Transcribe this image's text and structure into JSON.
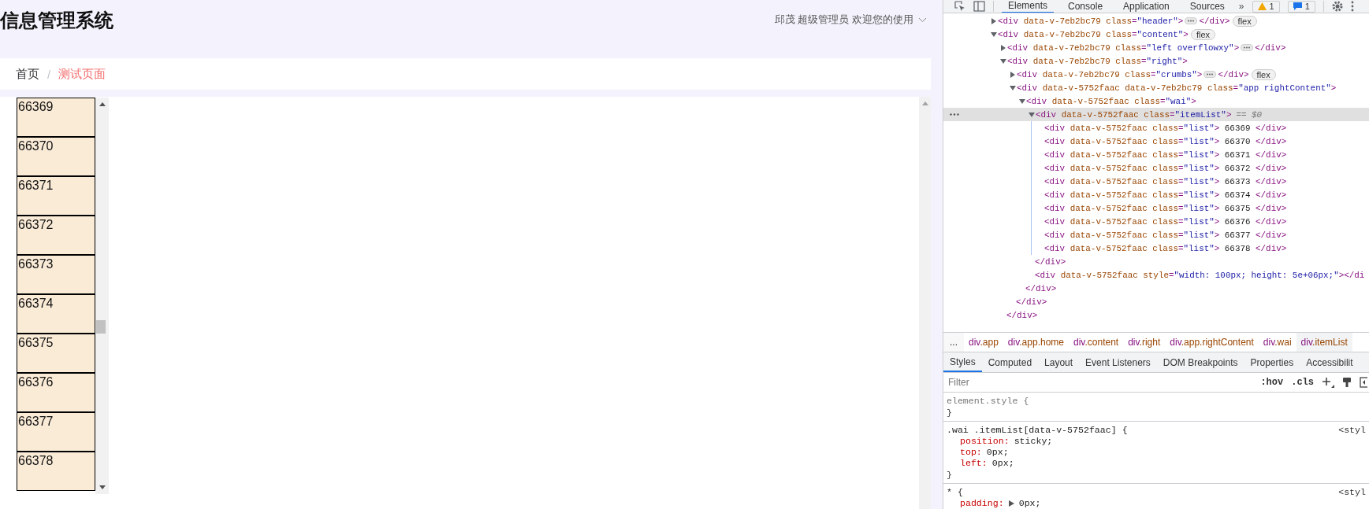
{
  "page": {
    "header": {
      "title": "信息管理系统",
      "user": "邱茂 超级管理员 欢迎您的使用"
    },
    "breadcrumb": {
      "separator": "/",
      "items": [
        {
          "label": "首页",
          "selected": false
        },
        {
          "label": "测试页面",
          "selected": true
        }
      ]
    },
    "list_items": [
      {
        "label": "66369"
      },
      {
        "label": "66370"
      },
      {
        "label": "66371"
      },
      {
        "label": "66372"
      },
      {
        "label": "66373"
      },
      {
        "label": "66374"
      },
      {
        "label": "66375"
      },
      {
        "label": "66376"
      },
      {
        "label": "66377"
      },
      {
        "label": "66378"
      }
    ]
  },
  "devtools": {
    "tabs": [
      {
        "label": "Elements",
        "selected": true
      },
      {
        "label": "Console",
        "selected": false
      },
      {
        "label": "Application",
        "selected": false
      },
      {
        "label": "Sources",
        "selected": false
      }
    ],
    "more": "»",
    "warnings": "1",
    "messages": "1",
    "dom_tree": [
      {
        "kind": "element",
        "open": "<div data-v-7eb2bc79 class=\"header\">",
        "close": "</div>",
        "badge": "flex",
        "expanded": false,
        "selected": false
      },
      {
        "kind": "element",
        "open": "<div data-v-7eb2bc79 class=\"content\">",
        "badge": "flex",
        "expanded": true,
        "selected": false,
        "children": [
          {
            "kind": "element",
            "open": "<div data-v-7eb2bc79 class=\"left overflowxy\">",
            "close": "</div>",
            "expanded": false,
            "selected": false
          },
          {
            "kind": "element",
            "open": "<div data-v-7eb2bc79 class=\"right\">",
            "close": "</div>",
            "expanded": true,
            "selected": false,
            "children": [
              {
                "kind": "element",
                "open": "<div data-v-7eb2bc79 class=\"crumbs\">",
                "close": "</div>",
                "badge": "flex",
                "expanded": false,
                "selected": false
              },
              {
                "kind": "element",
                "open": "<div data-v-5752faac data-v-7eb2bc79 class=\"app rightContent\">",
                "close": "</div>",
                "expanded": true,
                "selected": false,
                "children": [
                  {
                    "kind": "element",
                    "open": "<div data-v-5752faac class=\"wai\">",
                    "close": "</div>",
                    "expanded": true,
                    "selected": false,
                    "children": [
                      {
                        "kind": "element",
                        "open": "<div data-v-5752faac class=\"itemList\">",
                        "suffix": "== $0",
                        "close": "</div>",
                        "expanded": true,
                        "selected": true,
                        "children": [
                          {
                            "kind": "leaf",
                            "open": "<div data-v-5752faac class=\"list\"> 66369 </div>",
                            "selected": false
                          },
                          {
                            "kind": "leaf",
                            "open": "<div data-v-5752faac class=\"list\"> 66370 </div>",
                            "selected": false
                          },
                          {
                            "kind": "leaf",
                            "open": "<div data-v-5752faac class=\"list\"> 66371 </div>",
                            "selected": false
                          },
                          {
                            "kind": "leaf",
                            "open": "<div data-v-5752faac class=\"list\"> 66372 </div>",
                            "selected": false
                          },
                          {
                            "kind": "leaf",
                            "open": "<div data-v-5752faac class=\"list\"> 66373 </div>",
                            "selected": false
                          },
                          {
                            "kind": "leaf",
                            "open": "<div data-v-5752faac class=\"list\"> 66374 </div>",
                            "selected": false
                          },
                          {
                            "kind": "leaf",
                            "open": "<div data-v-5752faac class=\"list\"> 66375 </div>",
                            "selected": false
                          },
                          {
                            "kind": "leaf",
                            "open": "<div data-v-5752faac class=\"list\"> 66376 </div>",
                            "selected": false
                          },
                          {
                            "kind": "leaf",
                            "open": "<div data-v-5752faac class=\"list\"> 66377 </div>",
                            "selected": false
                          },
                          {
                            "kind": "leaf",
                            "open": "<div data-v-5752faac class=\"list\"> 66378 </div>",
                            "selected": false
                          }
                        ]
                      },
                      {
                        "kind": "leaf",
                        "open": "<div data-v-5752faac style=\"width: 100px; height: 5e+06px;\"></di",
                        "selected": false
                      }
                    ]
                  }
                ]
              }
            ]
          }
        ]
      }
    ],
    "breadcrumbs_more": "...",
    "breadcrumbs": [
      {
        "label": "div.app",
        "selected": false
      },
      {
        "label": "div.app.home",
        "selected": false
      },
      {
        "label": "div.content",
        "selected": false
      },
      {
        "label": "div.right",
        "selected": false
      },
      {
        "label": "div.app.rightContent",
        "selected": false
      },
      {
        "label": "div.wai",
        "selected": false
      },
      {
        "label": "div.itemList",
        "selected": true
      }
    ],
    "pane_tabs": [
      {
        "label": "Styles",
        "selected": true
      },
      {
        "label": "Computed",
        "selected": false
      },
      {
        "label": "Layout",
        "selected": false
      },
      {
        "label": "Event Listeners",
        "selected": false
      },
      {
        "label": "DOM Breakpoints",
        "selected": false
      },
      {
        "label": "Properties",
        "selected": false
      },
      {
        "label": "Accessibilit",
        "selected": false
      }
    ],
    "filter": {
      "placeholder": "Filter"
    },
    "filter_buttons": [
      ":hov",
      ".cls"
    ],
    "rules": [
      {
        "kind": "inline",
        "selector": "element.style {",
        "close": "}"
      },
      {
        "kind": "rule",
        "selector": ".wai .itemList[data-v-5752faac] {",
        "source": "<styl",
        "close": "}",
        "declarations": [
          {
            "name": "position:",
            "value": "sticky;",
            "expandable": false
          },
          {
            "name": "top:",
            "value": "0px;",
            "expandable": false
          },
          {
            "name": "left:",
            "value": "0px;",
            "expandable": false
          }
        ]
      },
      {
        "kind": "rule",
        "selector": "* {",
        "source": "<styl",
        "declarations": [
          {
            "name": "padding:",
            "value": "0px;",
            "expandable": true
          }
        ]
      }
    ]
  }
}
